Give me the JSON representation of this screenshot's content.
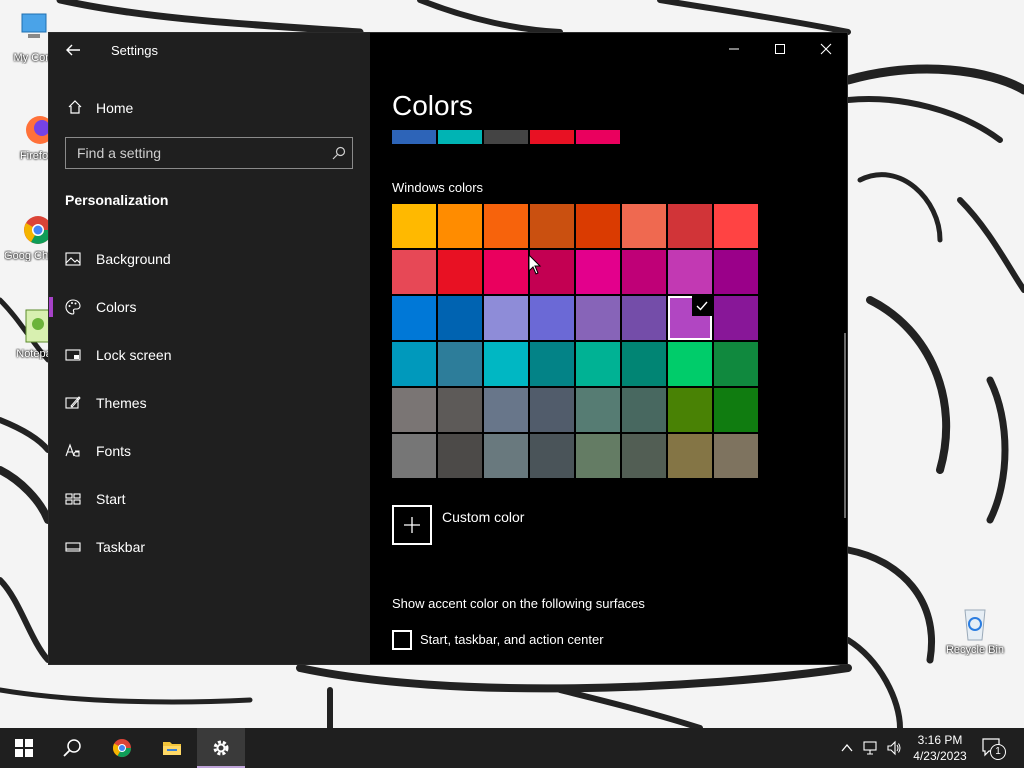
{
  "desktop": {
    "icons": [
      {
        "label": "My Com",
        "icon": "computer-icon"
      },
      {
        "label": "Firefo",
        "icon": "firefox-icon"
      },
      {
        "label": "Goog Chron",
        "icon": "chrome-icon"
      },
      {
        "label": "Notepa",
        "icon": "notepad-icon"
      }
    ],
    "recycle_bin": {
      "label": "Recycle Bin"
    }
  },
  "window": {
    "title": "Settings",
    "controls": {
      "minimize": "minimize-icon",
      "maximize": "maximize-icon",
      "close": "close-icon"
    }
  },
  "sidebar": {
    "home_label": "Home",
    "search_placeholder": "Find a setting",
    "search_value": "",
    "section_title": "Personalization",
    "items": [
      {
        "label": "Background",
        "icon": "picture-icon",
        "active": false
      },
      {
        "label": "Colors",
        "icon": "palette-icon",
        "active": true
      },
      {
        "label": "Lock screen",
        "icon": "lock-screen-icon",
        "active": false
      },
      {
        "label": "Themes",
        "icon": "themes-icon",
        "active": false
      },
      {
        "label": "Fonts",
        "icon": "fonts-icon",
        "active": false
      },
      {
        "label": "Start",
        "icon": "start-icon",
        "active": false
      },
      {
        "label": "Taskbar",
        "icon": "taskbar-icon",
        "active": false
      }
    ]
  },
  "content": {
    "title": "Colors",
    "recent_colors": [
      "#2d64b8",
      "#00b4b4",
      "#444444",
      "#e81123",
      "#ea005e"
    ],
    "windows_colors_label": "Windows colors",
    "swatches": [
      "#ffb900",
      "#ff8c00",
      "#f7630c",
      "#ca5010",
      "#da3b01",
      "#ef6950",
      "#d13438",
      "#ff4343",
      "#e74856",
      "#e81123",
      "#ea005e",
      "#c30052",
      "#e3008c",
      "#bf0077",
      "#c239b3",
      "#9a0089",
      "#0078d7",
      "#0063b1",
      "#8e8cd8",
      "#6b69d6",
      "#8764b8",
      "#744da9",
      "#b146c2",
      "#881798",
      "#0099bc",
      "#2d7d9a",
      "#00b7c3",
      "#038387",
      "#00b294",
      "#018574",
      "#00cc6a",
      "#10893e",
      "#7a7574",
      "#5d5a58",
      "#68768a",
      "#515c6b",
      "#567c73",
      "#486860",
      "#498205",
      "#107c10",
      "#767676",
      "#4c4a48",
      "#69797e",
      "#4a5459",
      "#647c64",
      "#525e54",
      "#847545",
      "#7e735f"
    ],
    "selected_swatch_index": 22,
    "custom_color_label": "Custom color",
    "surfaces_label": "Show accent color on the following surfaces",
    "checkbox_label": "Start, taskbar, and action center",
    "checkbox_checked": false
  },
  "taskbar": {
    "apps": [
      {
        "name": "start-button",
        "icon": "windows-logo-icon"
      },
      {
        "name": "search-button",
        "icon": "search-icon"
      },
      {
        "name": "chrome-button",
        "icon": "chrome-icon"
      },
      {
        "name": "file-explorer-button",
        "icon": "folder-icon"
      },
      {
        "name": "settings-button",
        "icon": "gear-icon",
        "active": true
      }
    ],
    "time": "3:16 PM",
    "date": "4/23/2023",
    "notification_count": "1"
  },
  "colors": {
    "accent": "#a742c9",
    "sidebar_bg": "#1f1f1f",
    "content_bg": "#000000",
    "taskbar_bg": "#1f1f1f"
  }
}
